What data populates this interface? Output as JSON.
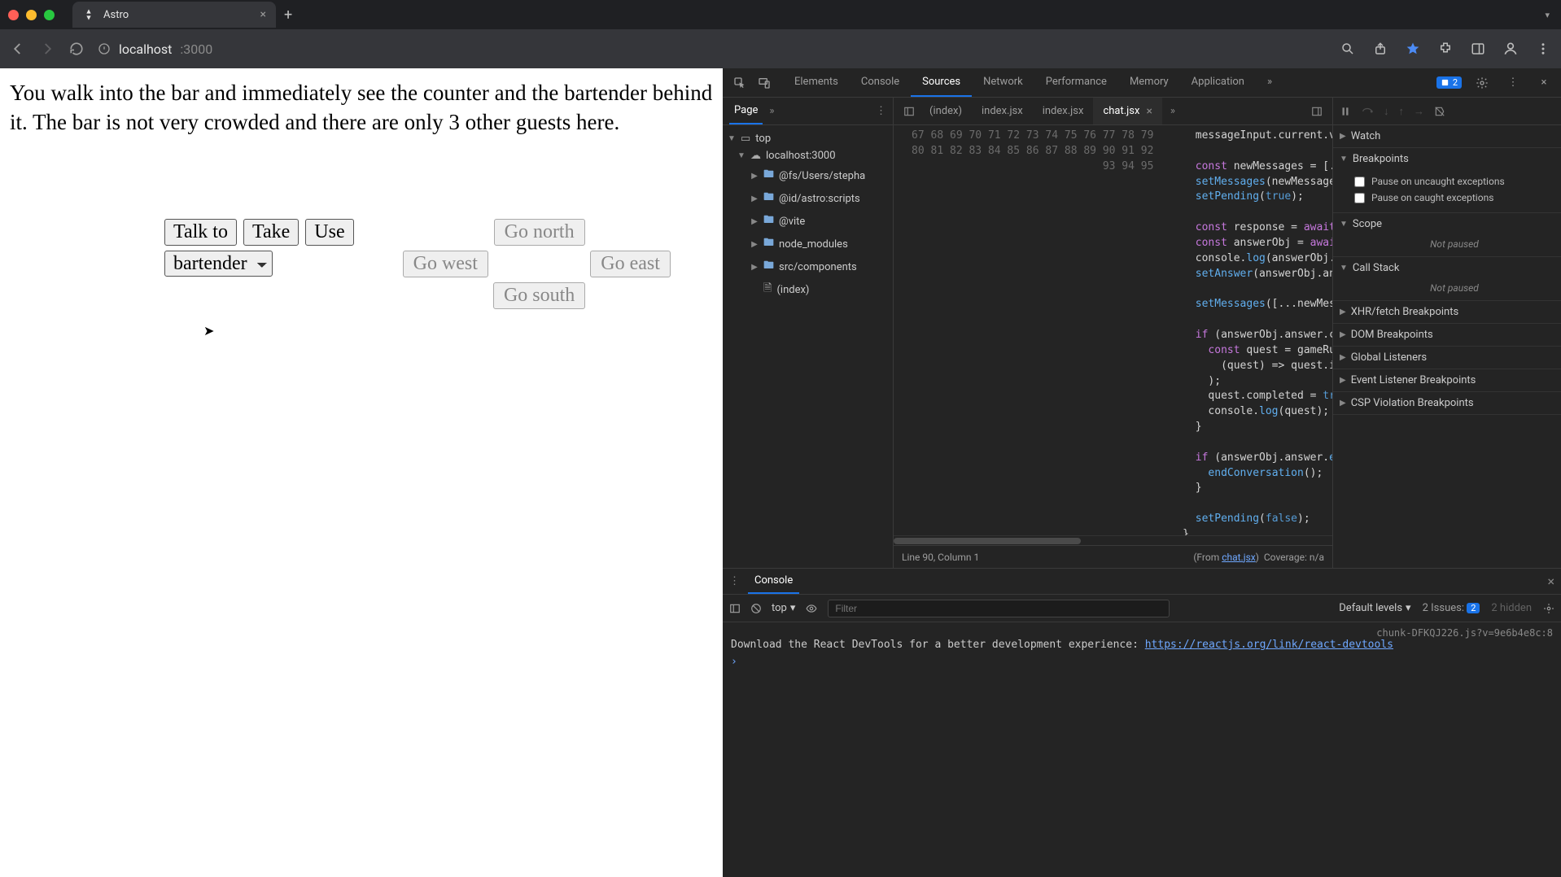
{
  "browser": {
    "tab_title": "Astro",
    "url_host": "localhost",
    "url_path": ":3000"
  },
  "page": {
    "narrative": "You walk into the bar and immediately see the counter and the bartender behind it. The bar is not very crowded and there are only 3 other guests here.",
    "actions": {
      "talk_to": "Talk to",
      "take": "Take",
      "use": "Use"
    },
    "target_select": "bartender",
    "nav": {
      "north": "Go north",
      "west": "Go west",
      "east": "Go east",
      "south": "Go south"
    }
  },
  "devtools": {
    "tabs": [
      "Elements",
      "Console",
      "Sources",
      "Network",
      "Performance",
      "Memory",
      "Application"
    ],
    "active_tab": "Sources",
    "issue_count": "2",
    "sources_nav": {
      "page_tab": "Page",
      "top": "top",
      "origin": "localhost:3000",
      "folders": [
        "@fs/Users/stepha",
        "@id/astro:scripts",
        "@vite",
        "node_modules",
        "src/components"
      ],
      "file": "(index)"
    },
    "file_tabs": [
      "(index)",
      "index.jsx",
      "index.jsx",
      "chat.jsx"
    ],
    "active_file": "chat.jsx",
    "gutter_start": 67,
    "code_lines": [
      "    messageInput.current.value = \"\";",
      "",
      "    const newMessages = [...messages, input];",
      "    setMessages(newMessages);",
      "    setPending(true);",
      "",
      "    const response = await fetch(`/api/chat?msg=${in",
      "    const answerObj = await response.json();",
      "    console.log(answerObj.answer);",
      "    setAnswer(answerObj.answer.content);",
      "",
      "    setMessages([...newMessages, answerObj.answer.co",
      "",
      "    if (answerObj.answer.completedQuest !== undefine",
      "      const quest = gameRuntimeData.quests.find(",
      "        (quest) => quest.id === answerObj.answer.com",
      "      );",
      "      quest.completed = true;",
      "      console.log(quest);",
      "    }",
      "",
      "    if (answerObj.answer.endConversation) {",
      "      endConversation();",
      "    }",
      "",
      "    setPending(false);",
      "  }",
      "}",
      ""
    ],
    "status": {
      "cursor": "Line 90, Column 1",
      "from": "(From ",
      "from_file": "chat.jsx",
      "coverage": "Coverage: n/a"
    },
    "debugger": {
      "sections": [
        "Watch",
        "Breakpoints",
        "Scope",
        "Call Stack",
        "XHR/fetch Breakpoints",
        "DOM Breakpoints",
        "Global Listeners",
        "Event Listener Breakpoints",
        "CSP Violation Breakpoints"
      ],
      "pause_uncaught": "Pause on uncaught exceptions",
      "pause_caught": "Pause on caught exceptions",
      "not_paused": "Not paused"
    },
    "console": {
      "tab": "Console",
      "context": "top",
      "filter_placeholder": "Filter",
      "levels": "Default levels",
      "issues_label": "2 Issues:",
      "issues_badge": "2",
      "hidden": "2 hidden",
      "source_loc": "chunk-DFKQJ226.js?v=9e6b4e8c:8",
      "message": "Download the React DevTools for a better development experience: ",
      "link": "https://reactjs.org/link/react-devtools"
    }
  }
}
